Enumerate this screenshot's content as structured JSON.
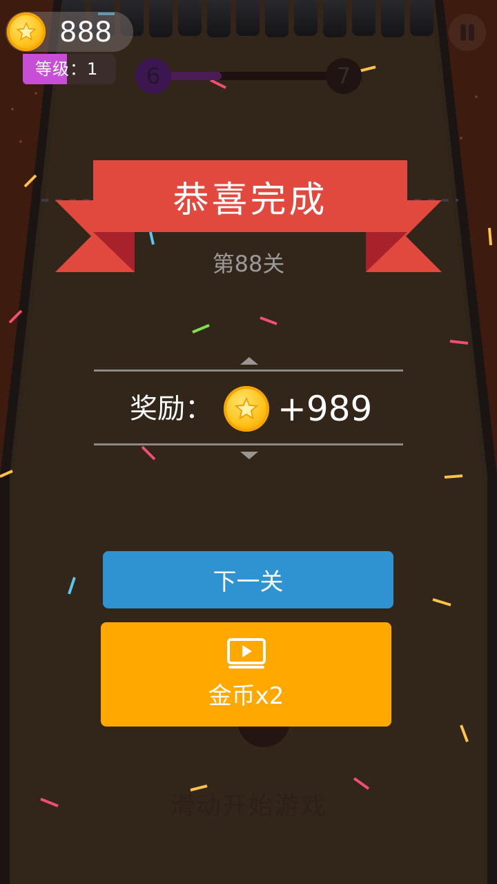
{
  "hud": {
    "coin_count": "888",
    "level_label": "等级：1",
    "current_stage": "6",
    "next_stage": "7",
    "stage_progress": 0.35
  },
  "result": {
    "title": "恭喜完成",
    "stage_label": "第88关",
    "reward_label": "奖励：",
    "reward_amount": "+989"
  },
  "buttons": {
    "next_label": "下一关",
    "double_label": "金币x2"
  },
  "hint": "滑动开始游戏",
  "colors": {
    "ribbon": "#e1493f",
    "next_button": "#2f93d2",
    "double_button": "#ffa800",
    "level_badge": "#c84ed8",
    "coin": "#ffc21a"
  },
  "icons": {
    "coin": "star-coin-icon",
    "video": "video-play-icon",
    "pause": "pause-icon"
  }
}
